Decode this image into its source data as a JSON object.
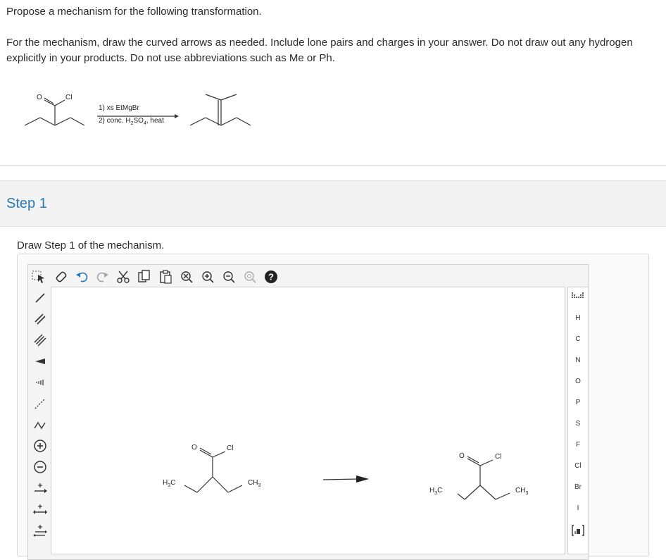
{
  "question": {
    "prompt": "Propose a mechanism for the following transformation.",
    "instructions_line1": "For the mechanism, draw the curved arrows as needed. Include lone pairs and charges in your answer. Do not draw out any hydrogen",
    "instructions_line2": "explicitly in your products. Do not use abbreviations such as Me or Ph."
  },
  "reaction": {
    "reactant_atoms": {
      "oxygen": "O",
      "chlorine": "Cl"
    },
    "condition_1": "1) xs EtMgBr",
    "condition_2_prefix": "2) conc. H",
    "condition_2_sub1": "2",
    "condition_2_mid": "SO",
    "condition_2_sub2": "4",
    "condition_2_suffix": ", heat"
  },
  "step": {
    "title": "Step 1",
    "instruction": "Draw Step 1 of the mechanism."
  },
  "canvas": {
    "left_molecule": {
      "oxygen": "O",
      "chlorine": "Cl",
      "h3c": "H",
      "h3c_sub": "3",
      "h3c_c": "C",
      "ch3": "CH",
      "ch3_sub": "3"
    },
    "right_molecule": {
      "oxygen": "O",
      "chlorine": "Cl",
      "h3c": "H",
      "h3c_sub": "3",
      "h3c_c": "C",
      "ch3": "CH",
      "ch3_sub": "3"
    }
  },
  "elements": [
    "H",
    "C",
    "N",
    "O",
    "P",
    "S",
    "F",
    "Cl",
    "Br",
    "I"
  ],
  "colors": {
    "accent": "#2a7ab8",
    "help": "#222222"
  }
}
